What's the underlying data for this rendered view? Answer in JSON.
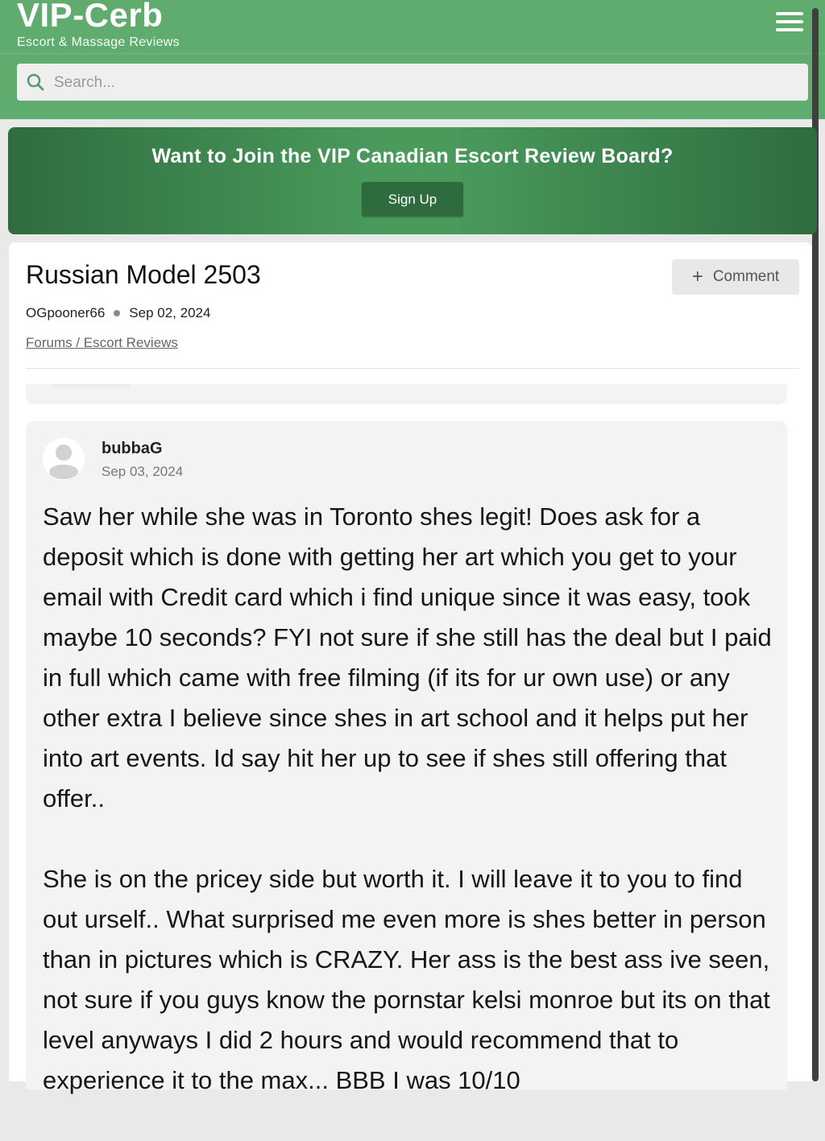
{
  "header": {
    "site_name": "VIP-Cerb",
    "tagline": "Escort & Massage Reviews",
    "search_placeholder": "Search..."
  },
  "banner": {
    "title": "Want to Join the VIP Canadian Escort Review Board?",
    "signup_label": "Sign Up"
  },
  "thread": {
    "title": "Russian Model 2503",
    "author": "OGpooner66",
    "date": "Sep 02, 2024",
    "breadcrumb": "Forums / Escort Reviews",
    "comment_label": "Comment"
  },
  "post": {
    "author": "bubbaG",
    "date": "Sep 03, 2024",
    "paragraph1": "Saw her while she was in Toronto shes legit! Does ask for a deposit which is done with getting her art which you get to your email with Credit card which i find unique since it was easy, took maybe 10 seconds? FYI not sure if she still has the deal but I paid in full which came with free filming (if its for ur own use) or any other extra I believe since shes in art school and it helps put her into art events. Id say hit her up to see if shes still offering that offer..",
    "paragraph2": "She is on the pricey side but worth it. I will leave it to you to find out urself.. What surprised me even more is shes better in person than in pictures which is CRAZY. Her ass is the best ass ive seen, not sure if you guys know the pornstar kelsi monroe but its on that level anyways I did 2 hours and would recommend that to experience it to the max... BBB I was 10/10"
  },
  "colors": {
    "header_green": "#5fac6e",
    "banner_dark": "#2f6c40",
    "banner_light": "#4a9a5c",
    "signup_bg": "#2e6b3f"
  },
  "icons": {
    "menu": "hamburger-menu-icon",
    "search": "search-icon",
    "comment": "plus-icon",
    "avatar": "default-user-avatar"
  }
}
